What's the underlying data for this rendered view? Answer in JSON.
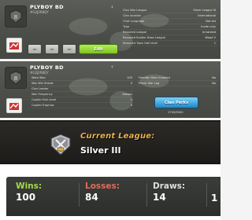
{
  "card1": {
    "player_name": "PLYBOY BD",
    "player_tag": "#G2J2R8QY",
    "share_icon": "share-icon",
    "info": [
      {
        "label": "Clan War League",
        "value": "Silver League III"
      },
      {
        "label": "Clan location",
        "value": "International"
      },
      {
        "label": "Chat Language",
        "value": "Not set"
      },
      {
        "label": "Type",
        "value": "Invite only"
      },
      {
        "label": "Required League",
        "value": "Unranked"
      },
      {
        "label": "Required Builder Base League",
        "value": "Wood V"
      },
      {
        "label": "Required Town Hall level",
        "value": "1"
      }
    ],
    "minus_label": "−",
    "edit_label": "Edit"
  },
  "card2": {
    "player_name": "PLYBOY BD",
    "player_tag": "#G2J2R8QY",
    "info_left": [
      {
        "label": "Wars Won",
        "value": "100"
      },
      {
        "label": "War Win Streak",
        "value": "0"
      },
      {
        "label": "Clan Leader",
        "value": ""
      },
      {
        "label": "War Frequency",
        "value": "Always"
      },
      {
        "label": "Capital Hall Level",
        "value": "1"
      },
      {
        "label": "Capital Trophies",
        "value": "0"
      }
    ],
    "info_right": [
      {
        "label": "Friendly Wars Enabled",
        "value": "No"
      },
      {
        "label": "Public War Log",
        "value": "No"
      }
    ],
    "clan_perks_label": "Clan Perks",
    "clan_mini_text": "2700/5000"
  },
  "league": {
    "current_label": "Current League:",
    "league_name": "Silver III",
    "badge_icon": "silver-league-badge-icon"
  },
  "stats": {
    "wins_label": "Wins:",
    "wins_value": "100",
    "losses_label": "Losses:",
    "losses_value": "84",
    "draws_label": "Draws:",
    "draws_value": "14",
    "extra_value": "1"
  },
  "colors": {
    "edit_green": "#7cc31f",
    "clan_blue": "#1f86c9",
    "league_gold": "#e7b24f",
    "wins_green": "#a6d94a",
    "losses_red": "#e16b5a"
  }
}
